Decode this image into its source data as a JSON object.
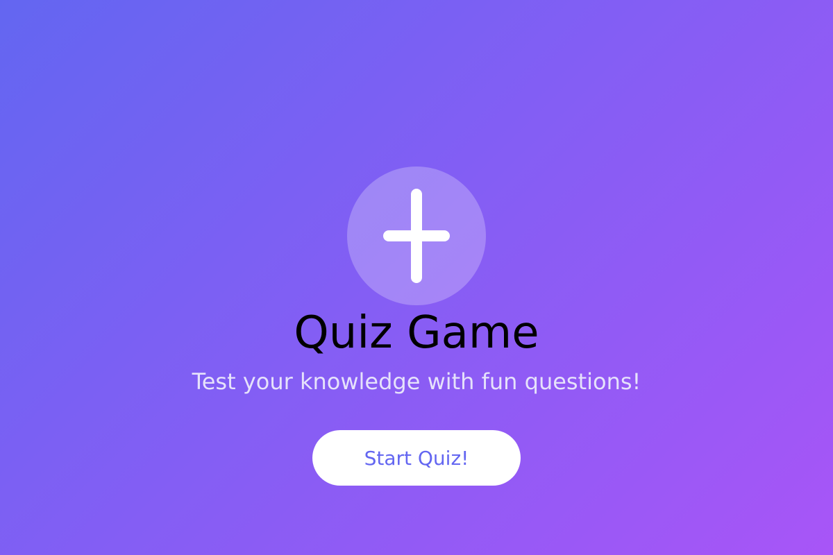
{
  "logo": {
    "icon": "plus-icon"
  },
  "title": "Quiz Game",
  "subtitle": "Test your knowledge with fun questions!",
  "start_button_label": "Start Quiz!",
  "colors": {
    "gradient_start": "#6366f1",
    "gradient_end": "#a855f7",
    "button_background": "#ffffff",
    "button_text": "#6366f1",
    "title_text": "#000000"
  }
}
